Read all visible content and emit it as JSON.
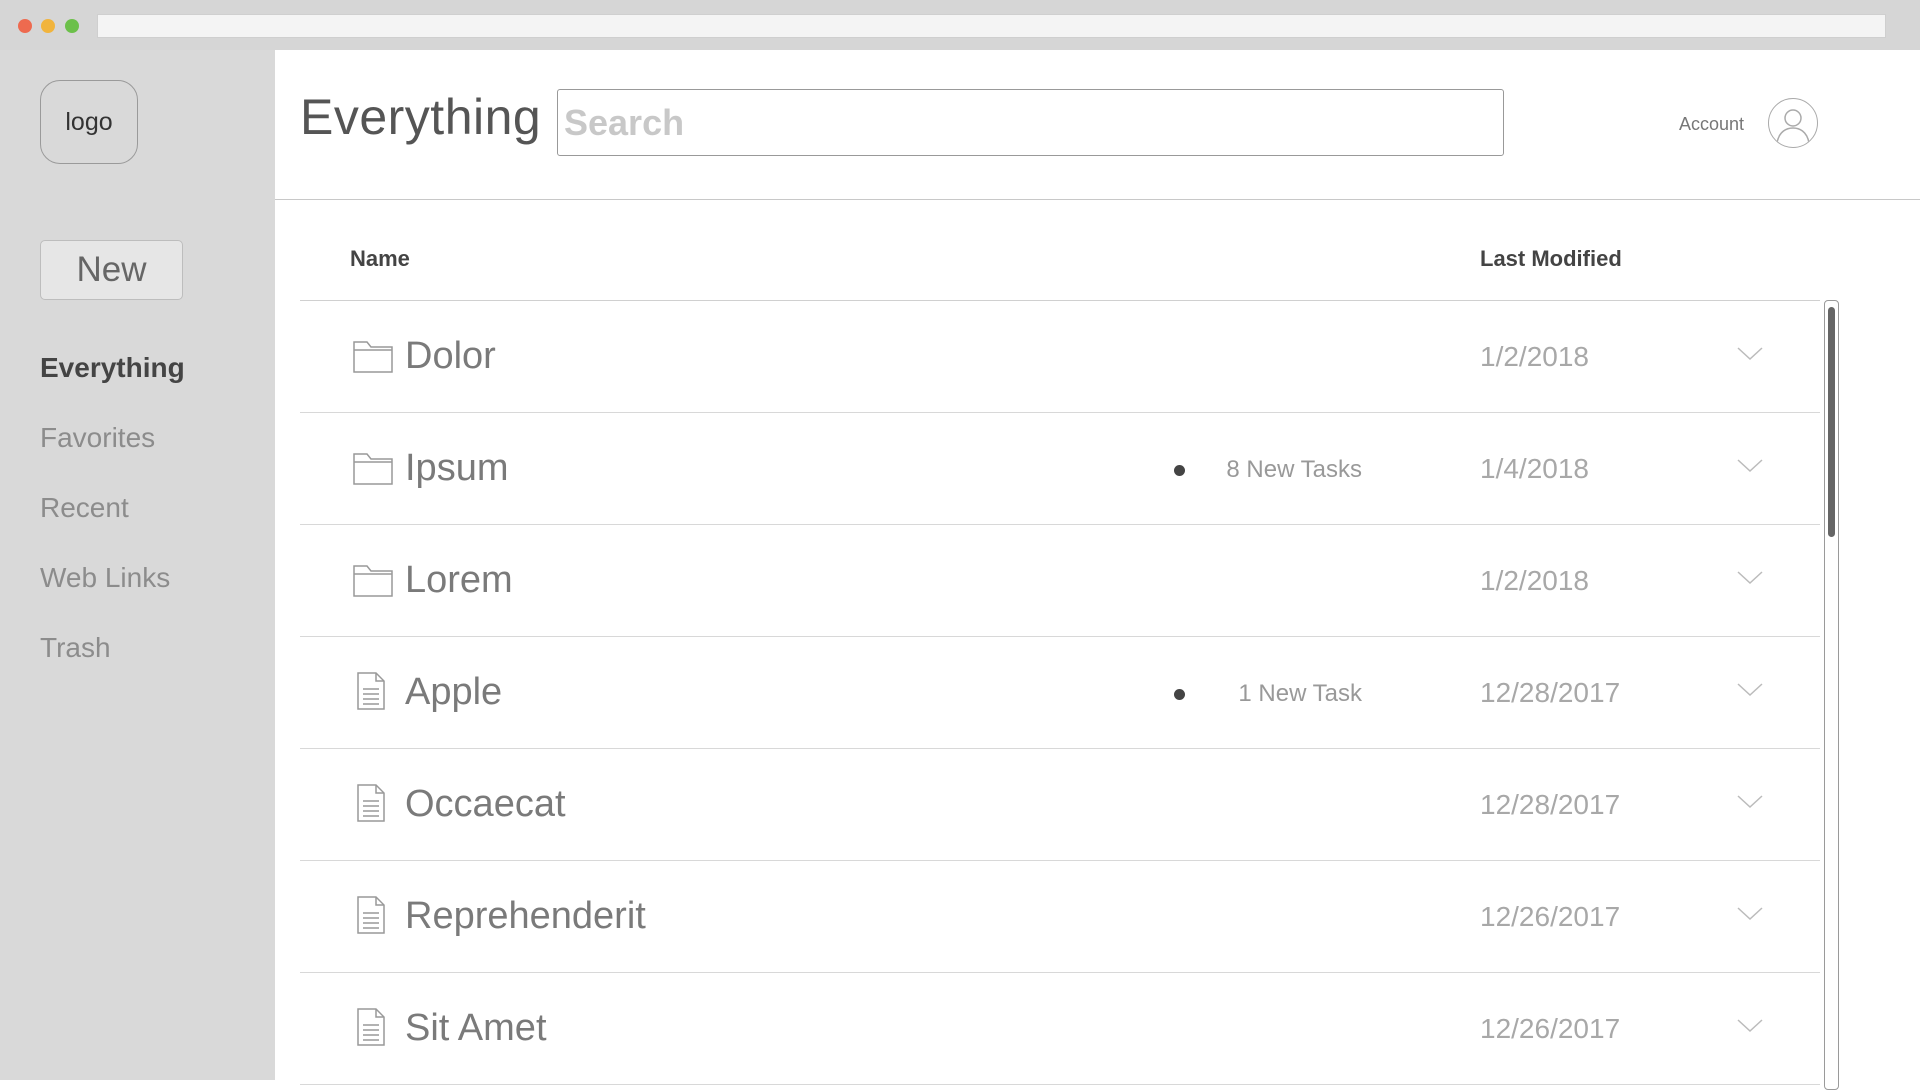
{
  "sidebar": {
    "logo_text": "logo",
    "new_label": "New",
    "items": [
      {
        "label": "Everything",
        "active": true
      },
      {
        "label": "Favorites",
        "active": false
      },
      {
        "label": "Recent",
        "active": false
      },
      {
        "label": "Web Links",
        "active": false
      },
      {
        "label": "Trash",
        "active": false
      }
    ]
  },
  "header": {
    "title": "Everything",
    "search_placeholder": "Search",
    "account_label": "Account"
  },
  "table": {
    "columns": {
      "name": "Name",
      "modified": "Last Modified"
    },
    "rows": [
      {
        "icon": "folder-icon",
        "name": "Dolor",
        "tasks": "",
        "date": "1/2/2018"
      },
      {
        "icon": "folder-icon",
        "name": "Ipsum",
        "tasks": "8 New Tasks",
        "date": "1/4/2018"
      },
      {
        "icon": "folder-icon",
        "name": "Lorem",
        "tasks": "",
        "date": "1/2/2018"
      },
      {
        "icon": "document-icon",
        "name": "Apple",
        "tasks": "1 New Task",
        "date": "12/28/2017"
      },
      {
        "icon": "document-icon",
        "name": "Occaecat",
        "tasks": "",
        "date": "12/28/2017"
      },
      {
        "icon": "document-icon",
        "name": "Reprehenderit",
        "tasks": "",
        "date": "12/26/2017"
      },
      {
        "icon": "document-icon",
        "name": "Sit Amet",
        "tasks": "",
        "date": "12/26/2017"
      }
    ]
  },
  "colors": {
    "sidebar_bg": "#d9d9d9",
    "chrome_bg": "#d6d6d6",
    "close_dot": "#ee6a4f",
    "minimize_dot": "#f1b43d",
    "maximize_dot": "#6cc04a"
  }
}
